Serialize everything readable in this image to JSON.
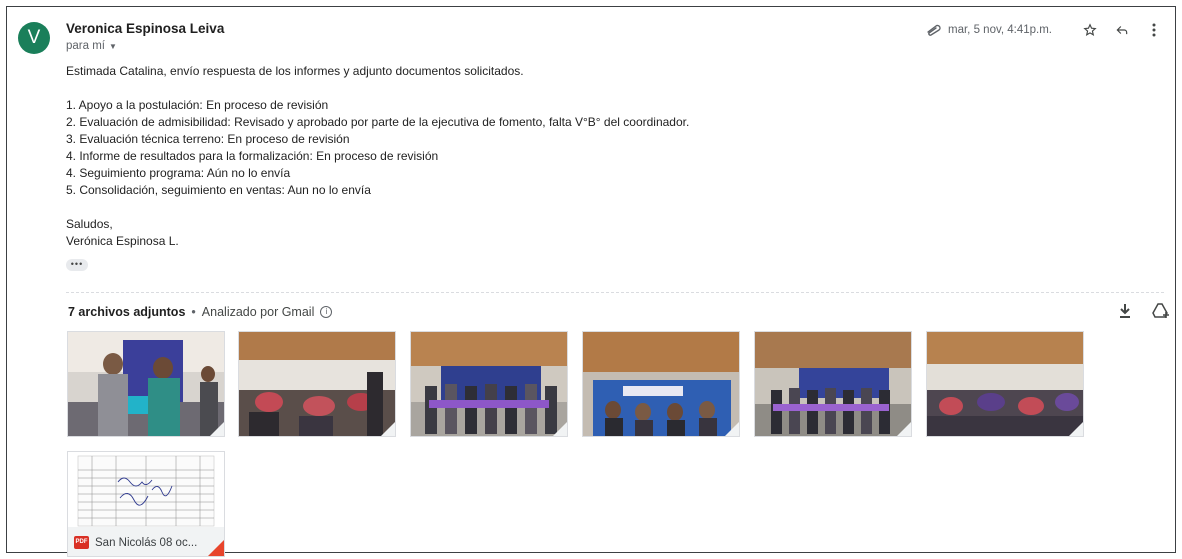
{
  "message": {
    "avatar_letter": "V",
    "sender_name": "Veronica Espinosa Leiva",
    "to_line": "para mí",
    "date": "mar, 5 nov, 4:41p.m.",
    "body": {
      "greeting": "Estimada Catalina, envío respuesta de los informes y adjunto documentos solicitados.",
      "items": [
        "1. Apoyo a la postulación: En proceso de revisión",
        "2. Evaluación de admisibilidad: Revisado y aprobado por parte de la ejecutiva de fomento, falta V°B° del coordinador.",
        "3. Evaluación técnica terreno: En proceso de revisión",
        "4. Informe de resultados para la formalización: En proceso de revisión",
        "4. Seguimiento programa: Aún no lo envía",
        "5. Consolidación, seguimiento en ventas: Aun no lo envía"
      ],
      "closing": "Saludos,",
      "signature": "Verónica Espinosa L."
    },
    "more_dots": "•••"
  },
  "attachments": {
    "count_label": "7 archivos adjuntos",
    "separator": "•",
    "scan_label": "Analizado por Gmail",
    "info_glyph": "i",
    "photos": [
      {
        "icon": "photo-thumbnail"
      },
      {
        "icon": "photo-thumbnail"
      },
      {
        "icon": "photo-thumbnail"
      },
      {
        "icon": "photo-thumbnail"
      },
      {
        "icon": "photo-thumbnail"
      },
      {
        "icon": "photo-thumbnail"
      }
    ],
    "pdf": {
      "badge": "PDF",
      "name": "San Nicolás 08 oc..."
    }
  },
  "icons": {
    "attachment": "paperclip-icon",
    "star": "star-icon",
    "reply": "reply-icon",
    "more": "more-vert-icon",
    "download": "download-icon",
    "drive": "add-to-drive-icon"
  },
  "colors": {
    "avatar": "#1a7f5a",
    "pdf_red": "#d93025"
  }
}
